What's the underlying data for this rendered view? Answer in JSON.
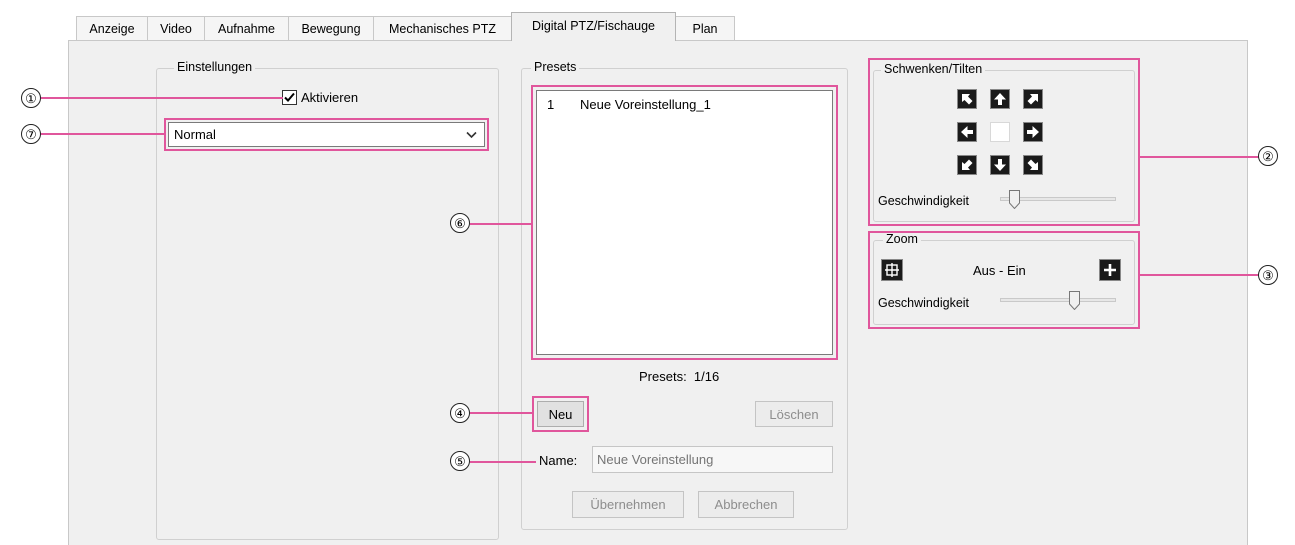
{
  "tabs": [
    "Anzeige",
    "Video",
    "Aufnahme",
    "Bewegung",
    "Mechanisches PTZ",
    "Digital PTZ/Fischauge",
    "Plan"
  ],
  "active_tab": "Digital PTZ/Fischauge",
  "settings": {
    "legend": "Einstellungen",
    "enable_label": "Aktivieren",
    "enable_checked": true,
    "mode_value": "Normal"
  },
  "presets": {
    "legend": "Presets",
    "items": [
      {
        "number": "1",
        "name": "Neue Voreinstellung_1"
      }
    ],
    "count_text": "Presets:  1/16",
    "new_label": "Neu",
    "delete_label": "Löschen",
    "name_label": "Name:",
    "name_placeholder": "Neue Voreinstellung",
    "apply_label": "Übernehmen",
    "cancel_label": "Abbrechen"
  },
  "pan_tilt": {
    "legend": "Schwenken/Tilten",
    "speed_label": "Geschwindigkeit",
    "speed_level": 0.1
  },
  "zoom": {
    "legend": "Zoom",
    "range_label": "Aus - Ein",
    "speed_label": "Geschwindigkeit",
    "speed_level": 0.65
  },
  "callouts": [
    "①",
    "②",
    "③",
    "④",
    "⑤",
    "⑥",
    "⑦"
  ],
  "colors": {
    "callout_pink": "#e0569c"
  },
  "icons": {
    "pan": [
      "arrow-up-left-icon",
      "arrow-up-icon",
      "arrow-up-right-icon",
      "arrow-left-icon",
      "arrow-right-icon",
      "arrow-down-left-icon",
      "arrow-down-icon",
      "arrow-down-right-icon"
    ],
    "zoom_out": "zoom-wide-icon",
    "zoom_in": "plus-icon"
  }
}
